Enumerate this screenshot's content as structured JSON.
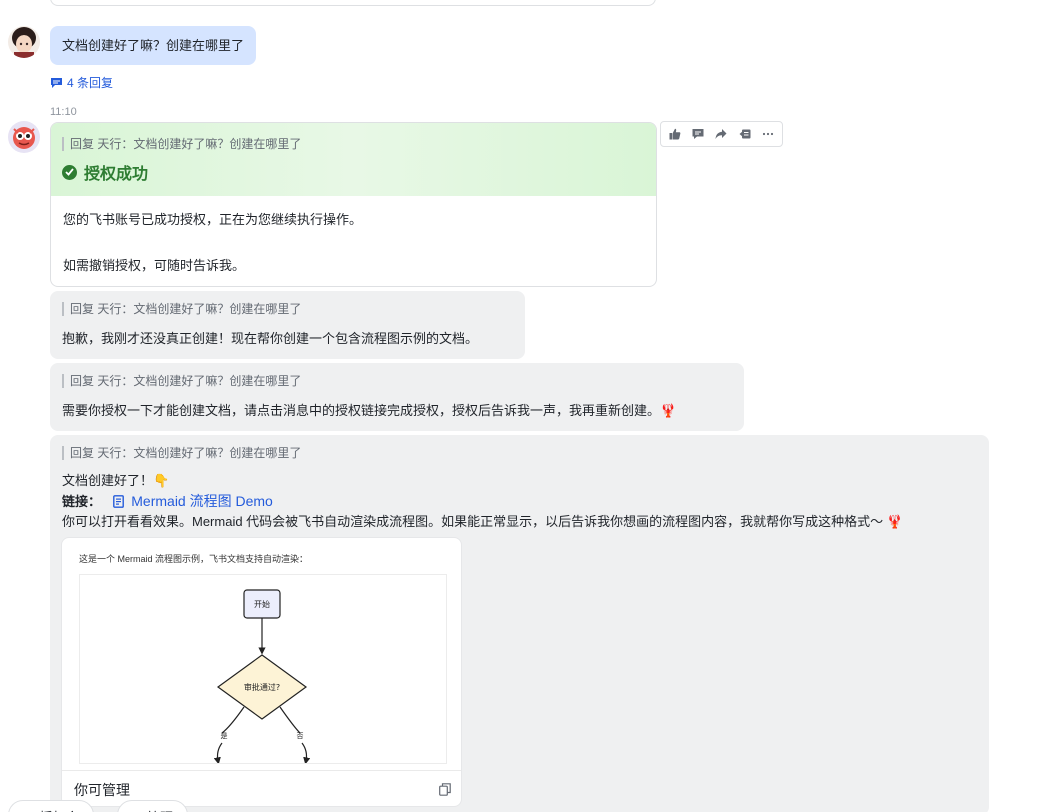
{
  "user_message": {
    "text": "文档创建好了嘛？创建在哪里了",
    "replies": "4 条回复"
  },
  "bot_time": "11:10",
  "quote_text": "回复 天行：文档创建好了嘛？创建在哪里了",
  "auth_card": {
    "title": "授权成功",
    "line1": "您的飞书账号已成功授权，正在为您继续执行操作。",
    "line2": "如需撤销授权，可随时告诉我。"
  },
  "toolbar": [
    "thumbs-up-icon",
    "comment-icon",
    "forward-icon",
    "reply-icon",
    "more-icon"
  ],
  "messages": {
    "m1": "抱歉，我刚才还没真正创建！现在帮你创建一个包含流程图示例的文档。",
    "m2": "需要你授权一下才能创建文档，请点击消息中的授权链接完成授权，授权后告诉我一声，我再重新创建。🦞",
    "m3_line1": "文档创建好了！👇",
    "m3_link_label": "链接：",
    "m3_link_text": "Mermaid 流程图 Demo",
    "m3_line3": "你可以打开看看效果。Mermaid 代码会被飞书自动渲染成流程图。如果能正常显示，以后告诉我你想画的流程图内容，我就帮你写成这种格式～ 🦞"
  },
  "preview": {
    "caption": "这是一个 Mermaid 流程图示例，飞书文档支持自动渲染：",
    "node_start": "开始",
    "node_decision": "审批通过?",
    "edge_yes": "是",
    "edge_no": "否",
    "footer": "你可管理"
  },
  "bottom_bar": {
    "pill1": "⌘ 授权令",
    "pill2": "⚙ 管理"
  },
  "colors": {
    "user_bubble": "#d5e4ff",
    "bot_bubble": "#eff0f1",
    "success_green": "#2e7d32",
    "link_blue": "#245bdb"
  }
}
